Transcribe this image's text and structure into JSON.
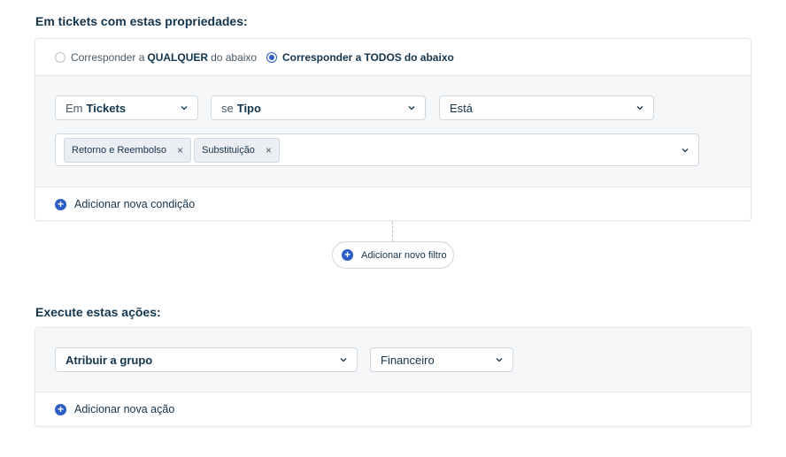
{
  "conditions_section": {
    "title": "Em tickets com estas propriedades:",
    "match_any": {
      "prefix": "Corresponder a",
      "keyword": "QUALQUER",
      "suffix": "do abaixo",
      "checked": false
    },
    "match_all": {
      "prefix": "Corresponder a",
      "keyword": "TODOS",
      "suffix": "do abaixo",
      "checked": true
    },
    "condition": {
      "entity": {
        "prefix": "Em",
        "value": "Tickets"
      },
      "field": {
        "prefix": "se",
        "value": "Tipo"
      },
      "operator": "Está",
      "values": [
        "Retorno e Reembolso",
        "Substituição"
      ]
    },
    "add_condition_label": "Adicionar nova condição",
    "add_filter_label": "Adicionar novo filtro"
  },
  "actions_section": {
    "title": "Execute estas ações:",
    "action": "Atribuir a grupo",
    "action_value": "Financeiro",
    "add_action_label": "Adicionar nova ação"
  },
  "colors": {
    "accent": "#2c5cc5",
    "text": "#12344d",
    "muted_bg": "#f5f7f9",
    "border": "#cfd7df"
  }
}
